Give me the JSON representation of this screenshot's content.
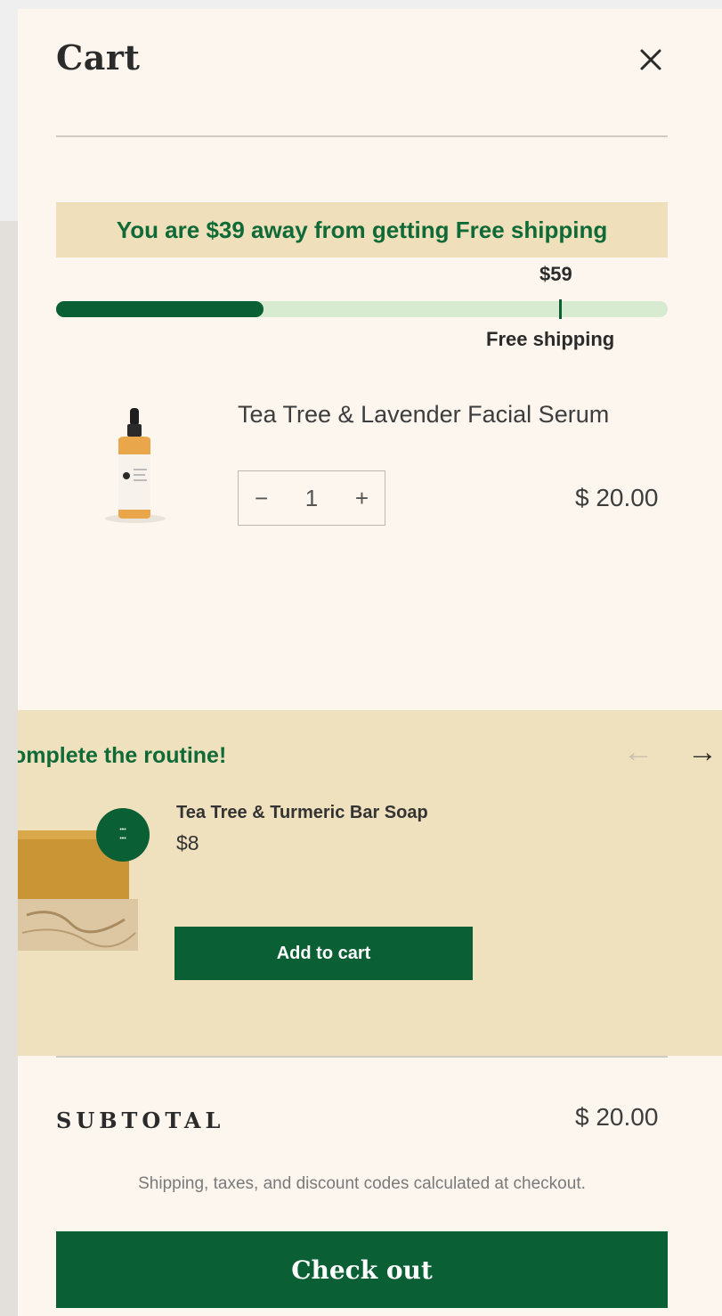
{
  "cart": {
    "title": "Cart",
    "close_icon": "close-icon"
  },
  "shipping": {
    "message": "You are $39 away from getting Free shipping",
    "goal_amount": "$59",
    "goal_label": "Free shipping",
    "progress_fraction": 0.339
  },
  "line_item": {
    "name": "Tea Tree & Lavender Facial Serum",
    "image_icon": "serum-bottle-image",
    "qty_minus": "−",
    "qty_value": "1",
    "qty_plus": "+",
    "price": "$ 20.00"
  },
  "upsell": {
    "title": "omplete the routine!",
    "prev_arrow": "←",
    "next_arrow": "→",
    "product_name": "Tea Tree & Turmeric Bar Soap",
    "product_price": "$8",
    "button_label": "Add to cart",
    "image_icon": "soap-bar-image"
  },
  "summary": {
    "subtotal_label": "SUBTOTAL",
    "subtotal_value": "$ 20.00",
    "note": "Shipping, taxes, and discount codes calculated at checkout.",
    "checkout_label": "Check out"
  },
  "colors": {
    "brand_green": "#0a5f34",
    "banner_bg": "#efe0bb",
    "drawer_bg": "#fcf6ee",
    "progress_track": "#d6ebd0"
  }
}
